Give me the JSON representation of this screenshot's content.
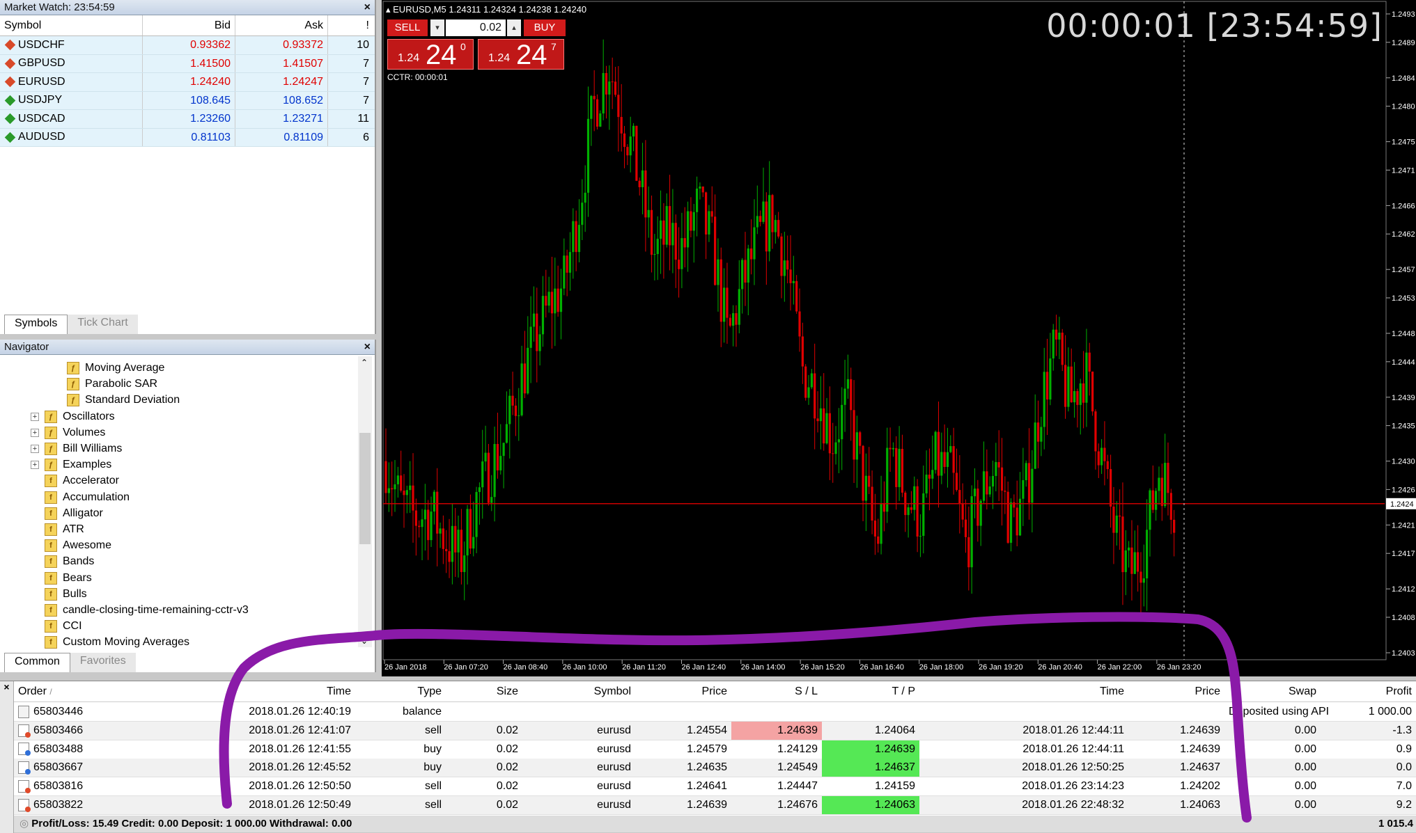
{
  "market_watch": {
    "title": "Market Watch: 23:54:59",
    "columns": [
      "Symbol",
      "Bid",
      "Ask",
      "!"
    ],
    "rows": [
      {
        "symbol": "USDCHF",
        "bid": "0.93362",
        "ask": "0.93372",
        "spread": "10",
        "dir": "down"
      },
      {
        "symbol": "GBPUSD",
        "bid": "1.41500",
        "ask": "1.41507",
        "spread": "7",
        "dir": "down"
      },
      {
        "symbol": "EURUSD",
        "bid": "1.24240",
        "ask": "1.24247",
        "spread": "7",
        "dir": "down"
      },
      {
        "symbol": "USDJPY",
        "bid": "108.645",
        "ask": "108.652",
        "spread": "7",
        "dir": "up"
      },
      {
        "symbol": "USDCAD",
        "bid": "1.23260",
        "ask": "1.23271",
        "spread": "11",
        "dir": "up"
      },
      {
        "symbol": "AUDUSD",
        "bid": "0.81103",
        "ask": "0.81109",
        "spread": "6",
        "dir": "up"
      }
    ],
    "tabs": [
      "Symbols",
      "Tick Chart"
    ]
  },
  "navigator": {
    "title": "Navigator",
    "items": [
      {
        "label": "Moving Average",
        "level": 2,
        "expand": false
      },
      {
        "label": "Parabolic SAR",
        "level": 2,
        "expand": false
      },
      {
        "label": "Standard Deviation",
        "level": 2,
        "expand": false
      },
      {
        "label": "Oscillators",
        "level": 1,
        "expand": true
      },
      {
        "label": "Volumes",
        "level": 1,
        "expand": true
      },
      {
        "label": "Bill Williams",
        "level": 1,
        "expand": true
      },
      {
        "label": "Examples",
        "level": 1,
        "expand": true
      },
      {
        "label": "Accelerator",
        "level": 1,
        "expand": false,
        "custom": true
      },
      {
        "label": "Accumulation",
        "level": 1,
        "expand": false,
        "custom": true
      },
      {
        "label": "Alligator",
        "level": 1,
        "expand": false,
        "custom": true
      },
      {
        "label": "ATR",
        "level": 1,
        "expand": false,
        "custom": true
      },
      {
        "label": "Awesome",
        "level": 1,
        "expand": false,
        "custom": true
      },
      {
        "label": "Bands",
        "level": 1,
        "expand": false,
        "custom": true
      },
      {
        "label": "Bears",
        "level": 1,
        "expand": false,
        "custom": true
      },
      {
        "label": "Bulls",
        "level": 1,
        "expand": false,
        "custom": true
      },
      {
        "label": "candle-closing-time-remaining-cctr-v3",
        "level": 1,
        "expand": false,
        "custom": true
      },
      {
        "label": "CCI",
        "level": 1,
        "expand": false,
        "custom": true
      },
      {
        "label": "Custom Moving Averages",
        "level": 1,
        "expand": false,
        "custom": true
      }
    ],
    "tabs": [
      "Common",
      "Favorites"
    ]
  },
  "chart": {
    "symbol_line": "EURUSD,M5  1.24311 1.24324 1.24238 1.24240",
    "clock": "00:00:01 [23:54:59]",
    "sell_label": "SELL",
    "buy_label": "BUY",
    "lot": "0.02",
    "sell_prefix": "1.24",
    "sell_big": "24",
    "sell_sup": "0",
    "buy_prefix": "1.24",
    "buy_big": "24",
    "buy_sup": "7",
    "cctr": "CCTR: 00:00:01",
    "current_price": "1.2424",
    "price_labels": [
      "1.2493",
      "1.2489",
      "1.2484",
      "1.2480",
      "1.2475",
      "1.2471",
      "1.2466",
      "1.2462",
      "1.2457",
      "1.2453",
      "1.2448",
      "1.2444",
      "1.2439",
      "1.2435",
      "1.2430",
      "1.2426",
      "1.2421",
      "1.2417",
      "1.2412",
      "1.2408",
      "1.2403"
    ],
    "time_labels": [
      "26 Jan 2018",
      "26 Jan 07:20",
      "26 Jan 08:40",
      "26 Jan 10:00",
      "26 Jan 11:20",
      "26 Jan 12:40",
      "26 Jan 14:00",
      "26 Jan 15:20",
      "26 Jan 16:40",
      "26 Jan 18:00",
      "26 Jan 19:20",
      "26 Jan 20:40",
      "26 Jan 22:00",
      "26 Jan 23:20"
    ],
    "colors": {
      "bull": "#00b000",
      "bear": "#e00000",
      "bg": "#000000",
      "price_line": "#cc0000"
    }
  },
  "chart_data": {
    "type": "candlestick",
    "symbol": "EURUSD",
    "timeframe": "M5",
    "ylim": [
      1.2403,
      1.2493
    ],
    "path_close": [
      1.243,
      1.2424,
      1.2422,
      1.2423,
      1.2419,
      1.2416,
      1.2424,
      1.2429,
      1.2433,
      1.2441,
      1.2447,
      1.2452,
      1.2455,
      1.2466,
      1.248,
      1.2486,
      1.2478,
      1.247,
      1.2459,
      1.2462,
      1.246,
      1.2466,
      1.246,
      1.2447,
      1.2455,
      1.2461,
      1.2465,
      1.2457,
      1.2443,
      1.244,
      1.2433,
      1.2438,
      1.2428,
      1.2418,
      1.2432,
      1.2425,
      1.2422,
      1.243,
      1.2428,
      1.2418,
      1.2425,
      1.243,
      1.2421,
      1.2425,
      1.2438,
      1.2446,
      1.2438,
      1.2443,
      1.2432,
      1.242,
      1.2414,
      1.2418,
      1.2429,
      1.2424
    ]
  },
  "terminal": {
    "columns": [
      "Order",
      "Time",
      "Type",
      "Size",
      "Symbol",
      "Price",
      "S / L",
      "T / P",
      "Time",
      "Price",
      "Swap",
      "Profit"
    ],
    "rows": [
      {
        "order": "65803446",
        "time": "2018.01.26 12:40:19",
        "type": "balance",
        "size": "",
        "symbol": "",
        "price": "",
        "sl": "",
        "tp": "",
        "ctime": "",
        "cprice": "",
        "swap": "Deposited using API",
        "profit": "1 000.00",
        "kind": "balance",
        "sl_hit": false,
        "tp_hit": false
      },
      {
        "order": "65803466",
        "time": "2018.01.26 12:41:07",
        "type": "sell",
        "size": "0.02",
        "symbol": "eurusd",
        "price": "1.24554",
        "sl": "1.24639",
        "tp": "1.24064",
        "ctime": "2018.01.26 12:44:11",
        "cprice": "1.24639",
        "swap": "0.00",
        "profit": "-1.3",
        "kind": "sell",
        "sl_hit": true,
        "tp_hit": false
      },
      {
        "order": "65803488",
        "time": "2018.01.26 12:41:55",
        "type": "buy",
        "size": "0.02",
        "symbol": "eurusd",
        "price": "1.24579",
        "sl": "1.24129",
        "tp": "1.24639",
        "ctime": "2018.01.26 12:44:11",
        "cprice": "1.24639",
        "swap": "0.00",
        "profit": "0.9",
        "kind": "buy",
        "sl_hit": false,
        "tp_hit": true
      },
      {
        "order": "65803667",
        "time": "2018.01.26 12:45:52",
        "type": "buy",
        "size": "0.02",
        "symbol": "eurusd",
        "price": "1.24635",
        "sl": "1.24549",
        "tp": "1.24637",
        "ctime": "2018.01.26 12:50:25",
        "cprice": "1.24637",
        "swap": "0.00",
        "profit": "0.0",
        "kind": "buy",
        "sl_hit": false,
        "tp_hit": true
      },
      {
        "order": "65803816",
        "time": "2018.01.26 12:50:50",
        "type": "sell",
        "size": "0.02",
        "symbol": "eurusd",
        "price": "1.24641",
        "sl": "1.24447",
        "tp": "1.24159",
        "ctime": "2018.01.26 23:14:23",
        "cprice": "1.24202",
        "swap": "0.00",
        "profit": "7.0",
        "kind": "sell",
        "sl_hit": false,
        "tp_hit": false
      },
      {
        "order": "65803822",
        "time": "2018.01.26 12:50:49",
        "type": "sell",
        "size": "0.02",
        "symbol": "eurusd",
        "price": "1.24639",
        "sl": "1.24676",
        "tp": "1.24063",
        "ctime": "2018.01.26 22:48:32",
        "cprice": "1.24063",
        "swap": "0.00",
        "profit": "9.2",
        "kind": "sell",
        "sl_hit": false,
        "tp_hit": true
      }
    ],
    "status_text": "Profit/Loss: 15.49  Credit: 0.00  Deposit: 1 000.00  Withdrawal: 0.00",
    "balance": "1 015.4"
  },
  "annotation_color": "#8a1aa8"
}
